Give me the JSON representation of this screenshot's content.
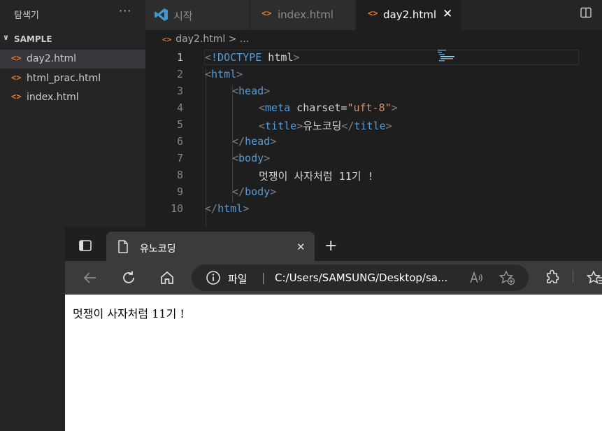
{
  "explorer": {
    "title": "탐색기",
    "more_label": "···",
    "folder": "SAMPLE",
    "files": [
      {
        "icon": "<>",
        "name": "day2.html"
      },
      {
        "icon": "<>",
        "name": "html_prac.html"
      },
      {
        "icon": "<>",
        "name": "index.html"
      }
    ]
  },
  "tabs": [
    {
      "label": "시작"
    },
    {
      "icon": "<>",
      "label": "index.html"
    },
    {
      "icon": "<>",
      "label": "day2.html",
      "close": "✕"
    }
  ],
  "breadcrumb": {
    "icon": "<>",
    "file": "day2.html",
    "rest": " > ..."
  },
  "editor": {
    "current_line": 1,
    "line_numbers": [
      "1",
      "2",
      "3",
      "4",
      "5",
      "6",
      "7",
      "8",
      "9",
      "10"
    ],
    "lines": [
      "<!DOCTYPE html>",
      "<html>",
      "<head>",
      "<meta charset=\"uft-8\">",
      "<title>유노코딩</title>",
      "</head>",
      "<body>",
      "멋쟁이 사자처럼 11기 !",
      "</body>",
      "</html>"
    ]
  },
  "browser": {
    "tab_title": "유노코딩",
    "tab_close": "✕",
    "new_tab": "+",
    "address_label": "파일",
    "address_sep": "|",
    "address_url": "C:/Users/SAMSUNG/Desktop/sa...",
    "page_text": "멋쟁이 사자처럼 11기 !"
  },
  "colors": {
    "accent_orange": "#e37933",
    "tag_blue": "#569cd6",
    "attr_lightblue": "#9cdcfe",
    "string_orange": "#ce9178",
    "vs_blue": "#3c99d4"
  }
}
